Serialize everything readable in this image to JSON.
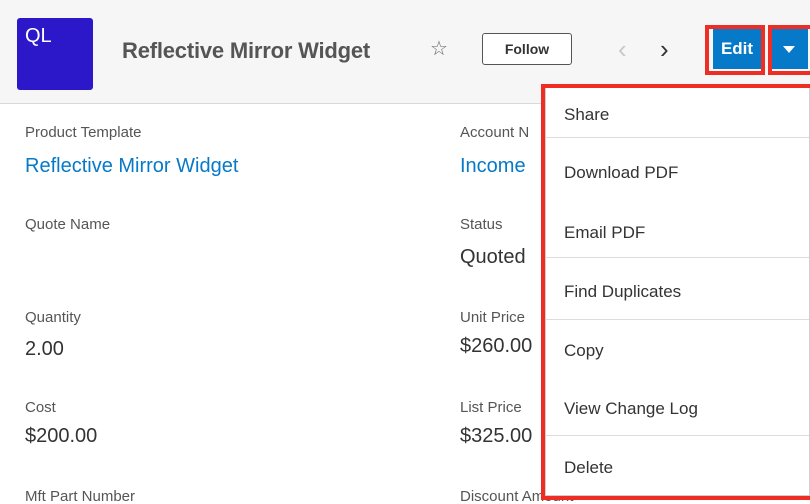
{
  "header": {
    "module_abbrev": "QL",
    "record_name": "Reflective Mirror Widget",
    "favorite_icon": "☆",
    "follow_label": "Follow",
    "prev_icon": "‹",
    "next_icon": "›",
    "edit_label": "Edit",
    "accent_color": "#0679c8",
    "badge_color": "#2c18c9",
    "highlight_color": "#ee2d24"
  },
  "fields_left": [
    {
      "label": "Product Template",
      "value": "Reflective Mirror Widget"
    },
    {
      "label": "Quote Name",
      "value": ""
    },
    {
      "label": "Quantity",
      "value": "2.00"
    },
    {
      "label": "Cost",
      "value": "$200.00"
    },
    {
      "label": "Mft Part Number",
      "value": ""
    }
  ],
  "fields_right": [
    {
      "label": "Account N",
      "value": "Income"
    },
    {
      "label": "Status",
      "value": "Quoted"
    },
    {
      "label": "Unit Price",
      "value": "$260.00"
    },
    {
      "label": "List Price",
      "value": "$325.00"
    },
    {
      "label": "Discount Amount",
      "value": ""
    }
  ],
  "actions_menu": {
    "items": [
      {
        "label": "Share"
      },
      {
        "label": "Download PDF"
      },
      {
        "label": "Email PDF"
      },
      {
        "label": "Find Duplicates"
      },
      {
        "label": "Copy"
      },
      {
        "label": "View Change Log"
      },
      {
        "label": "Delete"
      }
    ]
  }
}
